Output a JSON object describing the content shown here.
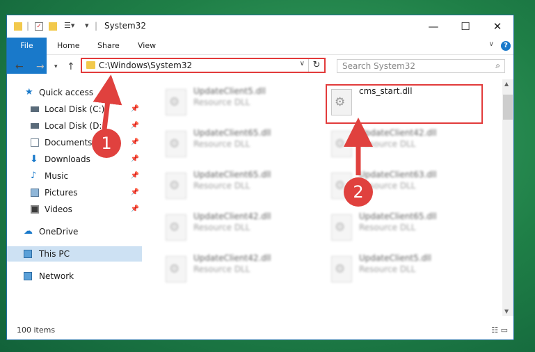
{
  "window": {
    "title": "System32"
  },
  "ribbon": {
    "tabs": [
      "File",
      "Home",
      "Share",
      "View"
    ],
    "help": "?"
  },
  "nav": {
    "address": "C:\\Windows\\System32",
    "search_placeholder": "Search System32"
  },
  "sidebar": {
    "items": [
      {
        "label": "Quick access",
        "icon": "star-icon",
        "pinned": false
      },
      {
        "label": "Local Disk (C:)",
        "icon": "drive-icon",
        "pinned": true
      },
      {
        "label": "Local Disk (D:)",
        "icon": "drive-icon",
        "pinned": true
      },
      {
        "label": "Documents",
        "icon": "documents-icon",
        "pinned": true
      },
      {
        "label": "Downloads",
        "icon": "download-icon",
        "pinned": true
      },
      {
        "label": "Music",
        "icon": "music-icon",
        "pinned": true
      },
      {
        "label": "Pictures",
        "icon": "pictures-icon",
        "pinned": true
      },
      {
        "label": "Videos",
        "icon": "videos-icon",
        "pinned": true
      },
      {
        "label": "OneDrive",
        "icon": "cloud-icon",
        "pinned": false
      },
      {
        "label": "This PC",
        "icon": "computer-icon",
        "pinned": false,
        "selected": true
      },
      {
        "label": "Network",
        "icon": "network-icon",
        "pinned": false
      }
    ]
  },
  "files": [
    {
      "name": "UpdateClient5.dll",
      "type": "Resource DLL"
    },
    {
      "name": "cms_start.dll",
      "type": ""
    },
    {
      "name": "UpdateClient65.dll",
      "type": "Resource DLL"
    },
    {
      "name": "UpdateClient42.dll",
      "type": "Resource DLL"
    },
    {
      "name": "UpdateClient65.dll",
      "type": "Resource DLL"
    },
    {
      "name": "UpdateClient63.dll",
      "type": "Resource DLL"
    },
    {
      "name": "UpdateClient42.dll",
      "type": "Resource DLL"
    },
    {
      "name": "UpdateClient65.dll",
      "type": "Resource DLL"
    },
    {
      "name": "UpdateClient42.dll",
      "type": "Resource DLL"
    },
    {
      "name": "UpdateClient5.dll",
      "type": "Resource DLL"
    }
  ],
  "status": {
    "count": "100 items"
  },
  "annotations": {
    "step1": "1",
    "step2": "2",
    "color": "#e0413e"
  }
}
